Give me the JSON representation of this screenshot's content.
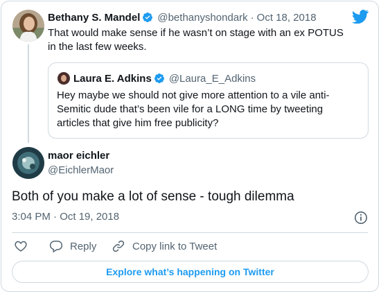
{
  "main_tweet": {
    "author_name": "Bethany S. Mandel",
    "handle": "@bethanyshondark",
    "separator": "·",
    "date": "Oct 18, 2018",
    "text": "That would make sense if he wasn’t on stage with an ex POTUS in the last few weeks.",
    "verified": true
  },
  "quoted_tweet": {
    "author_name": "Laura E. Adkins",
    "handle": "@Laura_E_Adkins",
    "text": "Hey maybe we should not give more attention to a vile anti-Semitic dude that’s been vile for a LONG time by tweeting articles that give him free publicity?",
    "verified": true
  },
  "reply_tweet": {
    "author_name": "maor eichler",
    "handle": "@EichlerMaor",
    "text": "Both of you make a lot of sense - tough dilemma",
    "timestamp": "3:04 PM · Oct 19, 2018"
  },
  "actions": {
    "reply_label": "Reply",
    "copy_link_label": "Copy link to Tweet"
  },
  "cta_label": "Explore what’s happening on Twitter",
  "icons": {
    "brand": "twitter-bird-icon",
    "verified": "verified-badge-icon",
    "info": "info-icon",
    "like": "heart-icon",
    "reply": "reply-bubble-icon",
    "link": "link-icon"
  },
  "colors": {
    "brand_blue": "#1d9bf0",
    "text": "#0f1419",
    "muted": "#536471",
    "border": "#cfd9de"
  }
}
